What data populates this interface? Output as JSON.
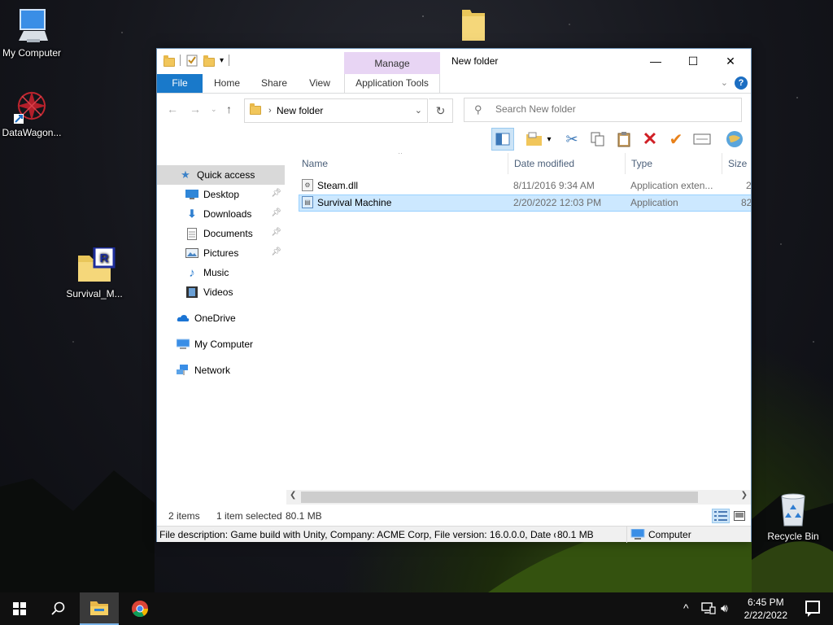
{
  "desktop": {
    "icons": [
      {
        "label": "My Computer",
        "icon": "monitor-icon"
      },
      {
        "label": "DataWagon...",
        "icon": "datawagon-icon"
      },
      {
        "label": "Survival_M...",
        "icon": "archive-folder-icon"
      },
      {
        "label": "Recycle Bin",
        "icon": "recycle-bin-icon"
      }
    ]
  },
  "window": {
    "title": "New folder",
    "manage_label": "Manage",
    "controls": {
      "minimize": "—",
      "maximize": "☐",
      "close": "✕"
    }
  },
  "ribbon": {
    "tabs": [
      "File",
      "Home",
      "Share",
      "View",
      "Application Tools"
    ],
    "help": "?"
  },
  "address": {
    "path": "New folder",
    "search_placeholder": "Search New folder"
  },
  "nav_pane": {
    "items": [
      {
        "label": "Quick access",
        "icon": "star-icon"
      },
      {
        "label": "Desktop",
        "icon": "desktop-icon",
        "pinned": true
      },
      {
        "label": "Downloads",
        "icon": "download-arrow-icon",
        "pinned": true
      },
      {
        "label": "Documents",
        "icon": "document-icon",
        "pinned": true
      },
      {
        "label": "Pictures",
        "icon": "picture-icon",
        "pinned": true
      },
      {
        "label": "Music",
        "icon": "music-note-icon"
      },
      {
        "label": "Videos",
        "icon": "film-icon"
      },
      {
        "label": "OneDrive",
        "icon": "cloud-icon"
      },
      {
        "label": "My Computer",
        "icon": "computer-icon"
      },
      {
        "label": "Network",
        "icon": "network-icon"
      }
    ]
  },
  "file_list": {
    "columns": [
      "Name",
      "Date modified",
      "Type",
      "Size"
    ],
    "rows": [
      {
        "name": "Steam.dll",
        "date": "8/11/2016 9:34 AM",
        "type": "Application exten...",
        "size": "2"
      },
      {
        "name": "Survival Machine",
        "date": "2/20/2022 12:03 PM",
        "type": "Application",
        "size": "82"
      }
    ]
  },
  "status": {
    "count": "2 items",
    "selected": "1 item selected",
    "size": "80.1 MB"
  },
  "infobar": {
    "description": "File description: Game build with Unity, Company: ACME Corp, File version: 16.0.0.0, Date cre",
    "size": "80.1 MB",
    "zone": "Computer"
  },
  "taskbar": {
    "time": "6:45 PM",
    "date": "2/22/2022"
  },
  "colors": {
    "accent": "#1979ca",
    "selection": "#cce8ff",
    "manage_tab": "#e8d5f4"
  }
}
